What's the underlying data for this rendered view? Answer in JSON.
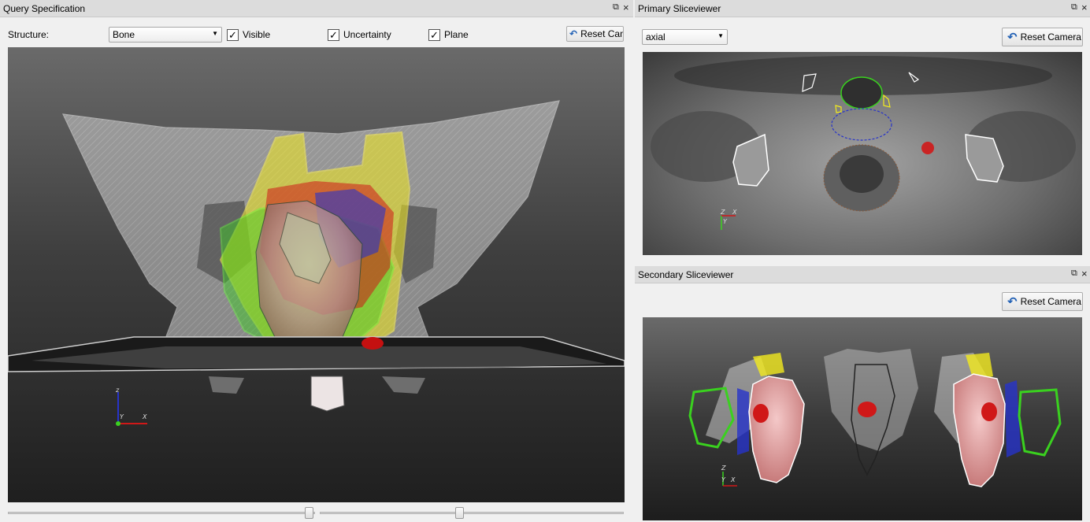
{
  "query_panel": {
    "title": "Query Specification",
    "float_icon": "float-icon",
    "close_label": "×",
    "structure_label": "Structure:",
    "structure_value": "Bone",
    "visible_label": "Visible",
    "uncertainty_label": "Uncertainty",
    "plane_label": "Plane",
    "reset_camera_label": "Reset Came",
    "check_mark": "✓",
    "axes": {
      "z": "z",
      "y": "Y",
      "x": "X"
    }
  },
  "primary_panel": {
    "title": "Primary Sliceviewer",
    "close_label": "×",
    "view_value": "axial",
    "reset_camera_label": "Reset Camera",
    "axes": {
      "z": "Z",
      "y": "Y",
      "x": "X"
    }
  },
  "secondary_panel": {
    "title": "Secondary Sliceviewer",
    "close_label": "×",
    "reset_camera_label": "Reset Camera",
    "axes": {
      "z": "Z",
      "y": "Y",
      "x": "X"
    }
  },
  "sliders": {
    "left_value": 0.5,
    "right_value": 0.46
  },
  "colors": {
    "titlebar": "#dcdcdc",
    "structure_yellow": "#f2ea1e",
    "structure_green": "#3ad11f",
    "structure_blue": "#2733c9",
    "structure_red": "#d01818",
    "reset_icon": "#1f5fb4"
  }
}
